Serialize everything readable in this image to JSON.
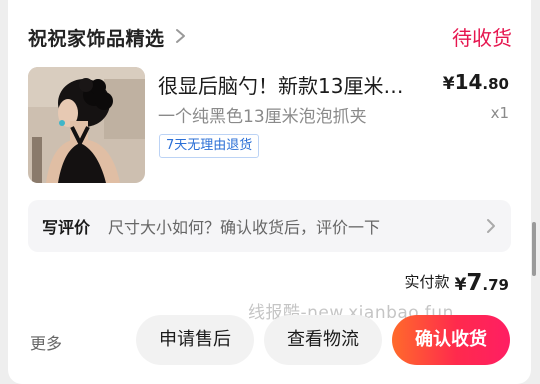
{
  "store": {
    "name": "祝祝家饰品精选",
    "status": "待收货"
  },
  "product": {
    "title": "很显后脑勺！新款13厘米…",
    "price_currency": "¥",
    "price_int": "14",
    "price_dec": ".80",
    "spec": "一个纯黑色13厘米泡泡抓夹",
    "qty": "x1",
    "service_tag": "7天无理由退货"
  },
  "review": {
    "label": "写评价",
    "prompt": "尺寸大小如何？确认收货后，评价一下"
  },
  "payment": {
    "label": "实付款",
    "currency": "¥",
    "int": "7",
    "dec": ".79"
  },
  "watermark": "线报酷-new.xianbao.fun",
  "actions": {
    "more": "更多",
    "after_sale": "申请售后",
    "logistics": "查看物流",
    "confirm": "确认收货"
  },
  "colors": {
    "status": "#e6164f",
    "tag_text": "#2b6fd6",
    "confirm_gradient_start": "#ff6a2b",
    "confirm_gradient_end": "#ff1e63"
  },
  "icons": [
    "chevron-right-icon",
    "chevron-right-icon"
  ]
}
